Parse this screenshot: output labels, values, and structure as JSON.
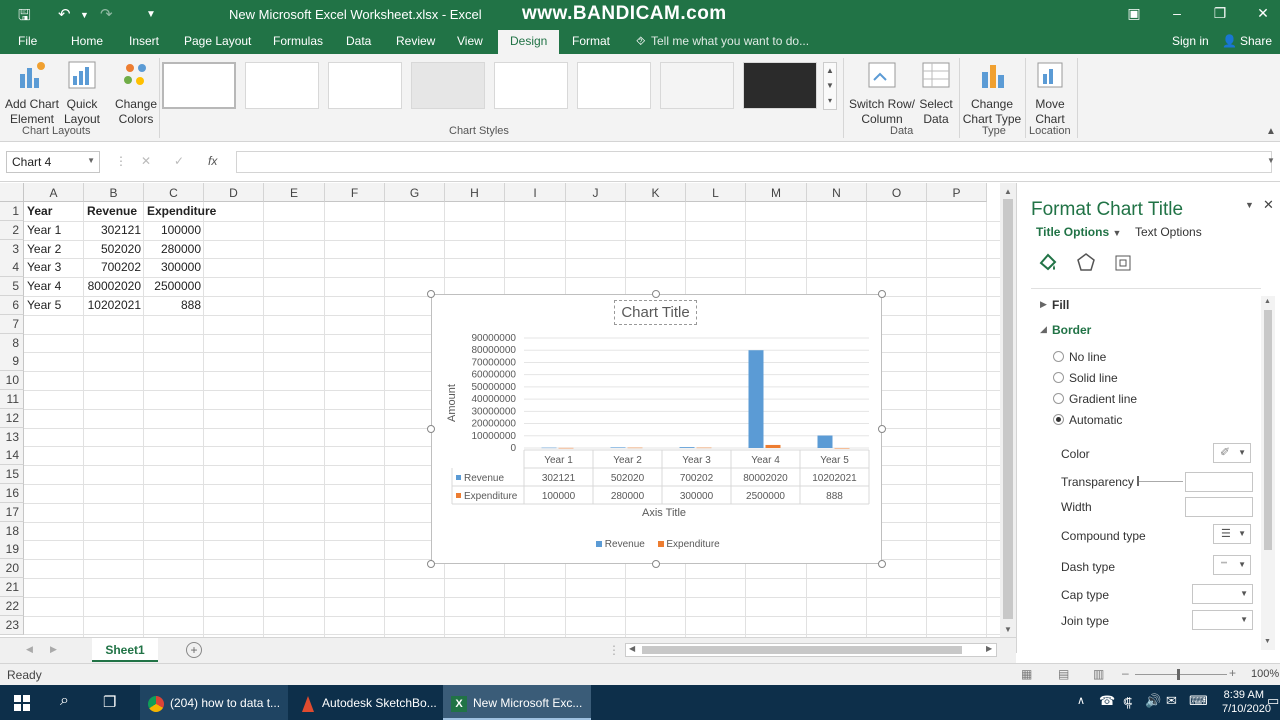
{
  "titlebar": {
    "document_title": "New Microsoft Excel Worksheet.xlsx - Excel",
    "watermark": "www.BANDICAM.com"
  },
  "tabs": {
    "file": "File",
    "home": "Home",
    "insert": "Insert",
    "page_layout": "Page Layout",
    "formulas": "Formulas",
    "data": "Data",
    "review": "Review",
    "view": "View",
    "design": "Design",
    "format": "Format",
    "tell_me": "Tell me what you want to do...",
    "sign_in": "Sign in",
    "share": "Share"
  },
  "ribbon": {
    "add_chart_element": "Add Chart\nElement",
    "quick_layout": "Quick\nLayout",
    "change_colors": "Change\nColors",
    "chart_layouts_label": "Chart Layouts",
    "chart_styles_label": "Chart Styles",
    "switch_row_column": "Switch Row/\nColumn",
    "select_data": "Select\nData",
    "data_label": "Data",
    "change_chart_type": "Change\nChart Type",
    "type_label": "Type",
    "move_chart": "Move\nChart",
    "location_label": "Location"
  },
  "formula_bar": {
    "name_box": "Chart 4",
    "fx": "fx"
  },
  "columns": [
    "A",
    "B",
    "C",
    "D",
    "E",
    "F",
    "G",
    "H",
    "I",
    "J",
    "K",
    "L",
    "M",
    "N",
    "O",
    "P"
  ],
  "rows": [
    "1",
    "2",
    "3",
    "4",
    "5",
    "6",
    "7",
    "8",
    "9",
    "10",
    "11",
    "12",
    "13",
    "14",
    "15",
    "16",
    "17",
    "18",
    "19",
    "20",
    "21",
    "22",
    "23"
  ],
  "sheet": {
    "headers": [
      "Year",
      "Revenue",
      "Expenditure"
    ],
    "data": [
      [
        "Year 1",
        "302121",
        "100000"
      ],
      [
        "Year 2",
        "502020",
        "280000"
      ],
      [
        "Year 3",
        "700202",
        "300000"
      ],
      [
        "Year 4",
        "80002020",
        "2500000"
      ],
      [
        "Year 5",
        "10202021",
        "888"
      ]
    ]
  },
  "chart_data": {
    "type": "bar",
    "title": "Chart Title",
    "xlabel": "Axis Title",
    "ylabel": "Amount",
    "categories": [
      "Year 1",
      "Year 2",
      "Year 3",
      "Year 4",
      "Year 5"
    ],
    "series": [
      {
        "name": "Revenue",
        "values": [
          302121,
          502020,
          700202,
          80002020,
          10202021
        ],
        "color": "#5b9bd5"
      },
      {
        "name": "Expenditure",
        "values": [
          100000,
          280000,
          300000,
          2500000,
          888
        ],
        "color": "#ed7d31"
      }
    ],
    "table_values": {
      "Revenue": [
        "302121",
        "502020",
        "700202",
        "80002020",
        "10202021"
      ],
      "Expenditure": [
        "100000",
        "280000",
        "300000",
        "2500000",
        "888"
      ]
    },
    "ylim": [
      0,
      90000000
    ],
    "yticks": [
      "90000000",
      "80000000",
      "70000000",
      "60000000",
      "50000000",
      "40000000",
      "30000000",
      "20000000",
      "10000000",
      "0"
    ],
    "legend_position": "bottom",
    "grid": true
  },
  "panel": {
    "title": "Format Chart Title",
    "title_options": "Title Options",
    "text_options": "Text Options",
    "fill": "Fill",
    "border": "Border",
    "no_line": "No line",
    "solid_line": "Solid line",
    "gradient_line": "Gradient line",
    "automatic": "Automatic",
    "color": "Color",
    "transparency": "Transparency",
    "width": "Width",
    "compound_type": "Compound type",
    "dash_type": "Dash type",
    "cap_type": "Cap type",
    "join_type": "Join type"
  },
  "sheet_tab": "Sheet1",
  "status": {
    "ready": "Ready",
    "zoom": "100%"
  },
  "taskbar": {
    "chrome": "(204) how to data t...",
    "sketchbook": "Autodesk SketchBo...",
    "excel": "New Microsoft Exc...",
    "time": "8:39 AM",
    "date": "7/10/2020"
  }
}
